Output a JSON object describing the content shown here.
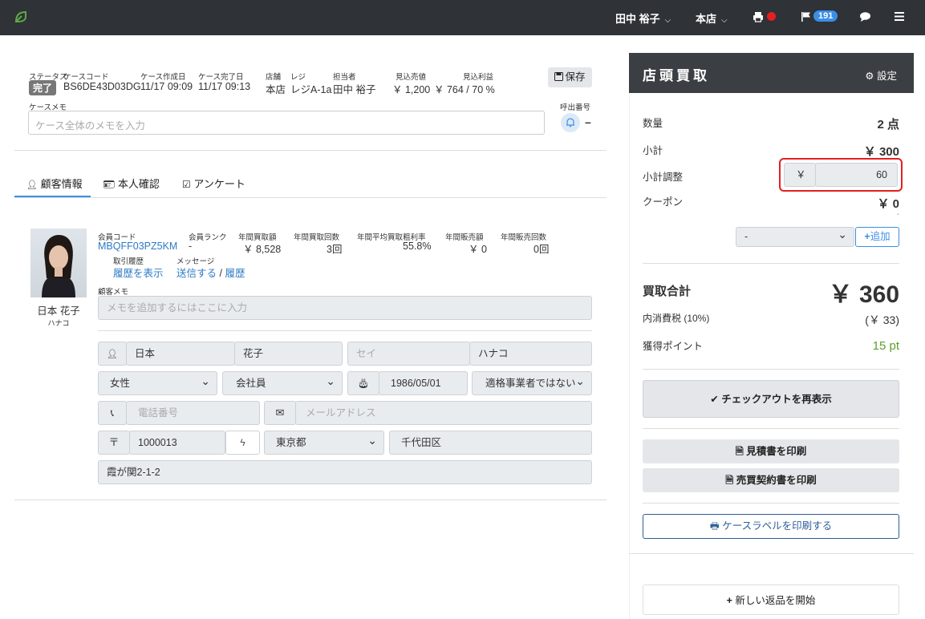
{
  "nav": {
    "user": "田中 裕子",
    "store": "本店",
    "badge_count": "191"
  },
  "case": {
    "status_label": "ステータス",
    "status_value": "完了",
    "code_label": "ケースコード",
    "code_value": "BS6DE43D03DG",
    "created_label": "ケース作成日",
    "created_value": "11/17 09:09",
    "completed_label": "ケース完了日",
    "completed_value": "11/17 09:13",
    "store_label": "店舗",
    "store_value": "本店",
    "register_label": "レジ",
    "register_value": "レジA-1a",
    "staff_label": "担当者",
    "staff_value": "田中 裕子",
    "est_sales_label": "見込売値",
    "est_sales_value": "￥ 1,200",
    "est_profit_label": "見込利益",
    "est_profit_value": "￥ 764 / 70 %",
    "save_label": "保存",
    "memo_label": "ケースメモ",
    "memo_placeholder": "ケース全体のメモを入力",
    "callnum_label": "呼出番号",
    "callnum_value": "–"
  },
  "tabs": [
    "顧客情報",
    "本人確認",
    "アンケート"
  ],
  "customer": {
    "name": "日本 花子",
    "kana": "ハナコ",
    "member_code_label": "会員コード",
    "member_code_value": "MBQFF03PZ5KM",
    "rank_label": "会員ランク",
    "rank_value": "-",
    "annual_buy_amount_label": "年間買取額",
    "annual_buy_amount_value": "￥ 8,528",
    "annual_buy_count_label": "年間買取回数",
    "annual_buy_count_value": "3回",
    "annual_margin_label": "年間平均買取粗利率",
    "annual_margin_value": "55.8%",
    "annual_sales_amount_label": "年間販売額",
    "annual_sales_amount_value": "￥ 0",
    "annual_sales_count_label": "年間販売回数",
    "annual_sales_count_value": "0回",
    "history_label": "取引履歴",
    "history_link": "履歴を表示",
    "message_label": "メッセージ",
    "message_send": "送信する",
    "message_sep": "/",
    "message_history": "履歴",
    "memo_label": "顧客メモ",
    "memo_placeholder": "メモを追加するにはここに入力",
    "last_name": "日本",
    "first_name": "花子",
    "last_kana_placeholder": "セイ",
    "first_kana": "ハナコ",
    "gender": "女性",
    "occupation": "会社員",
    "birthday": "1986/05/01",
    "invoice": "適格事業者ではない",
    "phone_placeholder": "電話番号",
    "email_placeholder": "メールアドレス",
    "postal_mark": "〒",
    "postal": "1000013",
    "prefecture": "東京都",
    "city": "千代田区",
    "address": "霞が関2-1-2"
  },
  "panel": {
    "title": "店頭買取",
    "settings": "設定",
    "qty_label": "数量",
    "qty_value": "2 点",
    "subtotal_label": "小計",
    "subtotal_value": "￥ 300",
    "adjust_label": "小計調整",
    "adjust_currency": "￥",
    "adjust_value": "60",
    "coupon_label": "クーポン",
    "coupon_value": "￥ 0",
    "coupon_dash": "-",
    "coupon_select": "-",
    "add_label": "追加",
    "total_label": "買取合計",
    "total_value": "￥ 360",
    "tax_label": "内消費税 (10%)",
    "tax_value": "(￥ 33)",
    "points_label": "獲得ポイント",
    "points_value": "15 pt",
    "checkout_btn": "チェックアウトを再表示",
    "quote_btn": "見積書を印刷",
    "contract_btn": "売買契約書を印刷",
    "label_btn": "ケースラベルを印刷する",
    "return_btn": "新しい返品を開始"
  },
  "colors": {
    "accent": "#3b8ee8",
    "nav_bg": "#2f3236",
    "highlight": "#e32020",
    "points": "#5aa02c"
  }
}
